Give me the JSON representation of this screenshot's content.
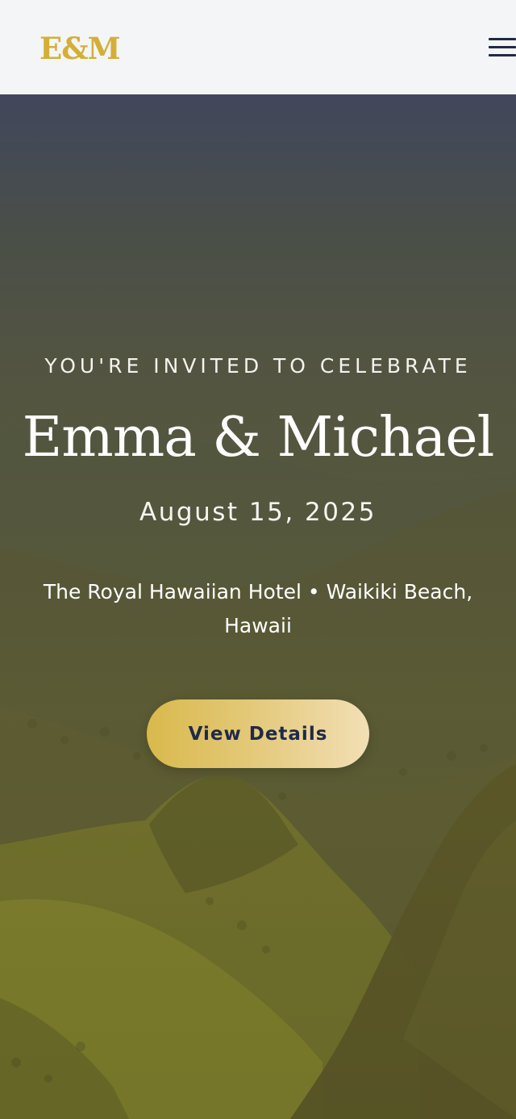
{
  "header": {
    "logo_text": "E&M",
    "menu_icon": "hamburger-menu-icon"
  },
  "hero": {
    "invite_line": "YOU'RE INVITED TO CELEBRATE",
    "couple_names": "Emma & Michael",
    "date": "August 15, 2025",
    "venue": "The Royal Hawaiian Hotel • Waikiki Beach, Hawaii",
    "cta_label": "View Details"
  },
  "colors": {
    "brand_gold": "#d4af37",
    "navy": "#1f2a4a",
    "header_bg": "#f4f5f7"
  }
}
